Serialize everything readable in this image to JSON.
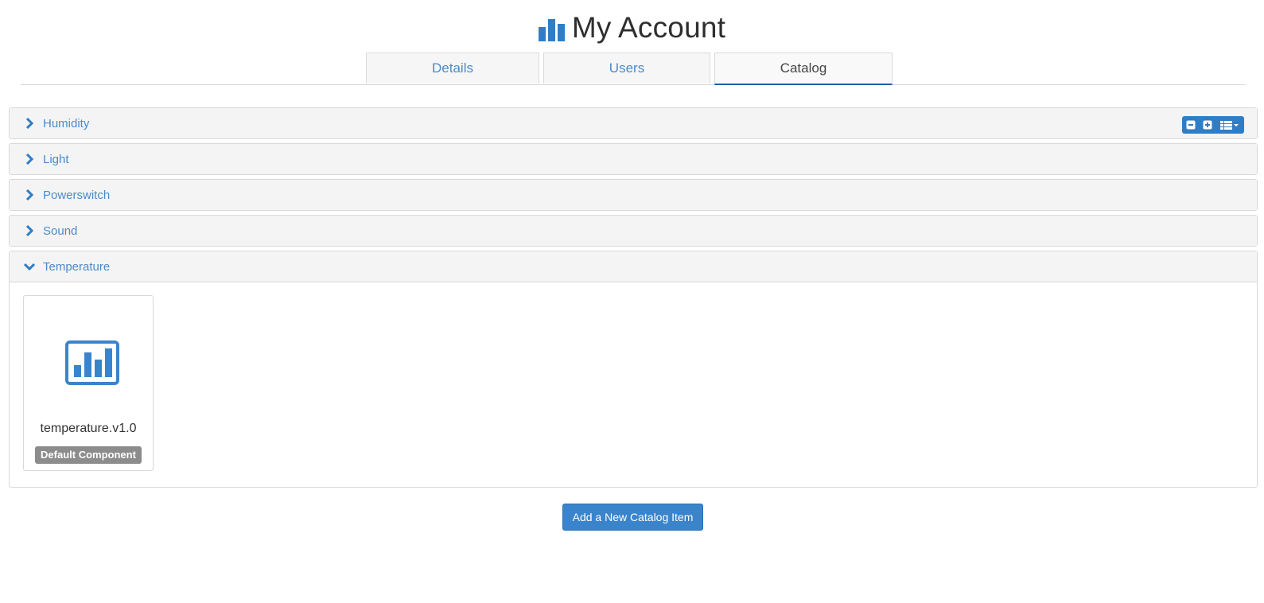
{
  "header": {
    "title": "My Account",
    "icon": "bar-chart-icon",
    "accent": "#2f7dc6"
  },
  "tabs": [
    {
      "label": "Details",
      "active": false
    },
    {
      "label": "Users",
      "active": false
    },
    {
      "label": "Catalog",
      "active": true
    }
  ],
  "catalog": {
    "groups": [
      {
        "label": "Humidity",
        "expanded": false
      },
      {
        "label": "Light",
        "expanded": false
      },
      {
        "label": "Powerswitch",
        "expanded": false
      },
      {
        "label": "Sound",
        "expanded": false
      },
      {
        "label": "Temperature",
        "expanded": true
      }
    ],
    "toolbar": {
      "collapse_icon": "minus-square-icon",
      "expand_icon": "plus-square-icon",
      "view_icon": "list-view-icon"
    },
    "items": [
      {
        "name": "temperature.v1.0",
        "badge": "Default Component",
        "icon": "chart-box-icon"
      }
    ]
  },
  "actions": {
    "add_label": "Add a New Catalog Item"
  },
  "colors": {
    "link": "#4a8bc8",
    "button": "#3a84cc",
    "badge": "#8c8c8c",
    "active_tab_border": "#1f5fa3"
  }
}
